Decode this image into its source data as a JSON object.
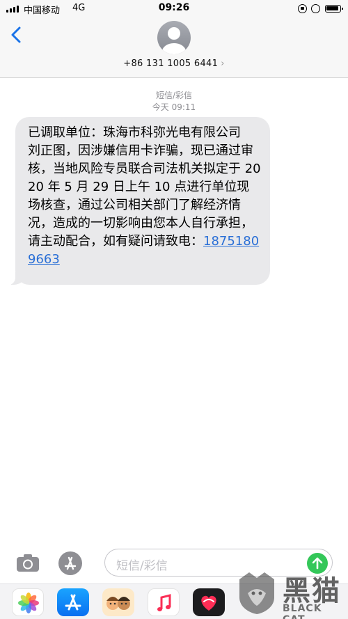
{
  "status_bar": {
    "carrier": "中国移动",
    "network": "4G",
    "time": "09:26"
  },
  "header": {
    "contact_number": "+86 131 1005 6441"
  },
  "thread": {
    "message_type": "短信/彩信",
    "timestamp": "今天 09:11",
    "message_text": "已调取单位：珠海市科弥光电有限公司\n刘正图，因涉嫌信用卡诈骗，现已通过审核，当地风险专员联合司法机关拟定于 2020 年 5 月 29 日上午 10 点进行单位现场核查，通过公司相关部门了解经济情况，造成的一切影响由您本人自行承担，请主动配合，如有疑问请致电：",
    "phone_link": "18751809663"
  },
  "composer": {
    "placeholder": "短信/彩信"
  },
  "colors": {
    "link": "#2a6fd6",
    "send_button": "#34c759",
    "bubble": "#e9e9eb"
  },
  "watermark": {
    "text_cn": "黑猫",
    "text_en": "BLACK CAT"
  }
}
